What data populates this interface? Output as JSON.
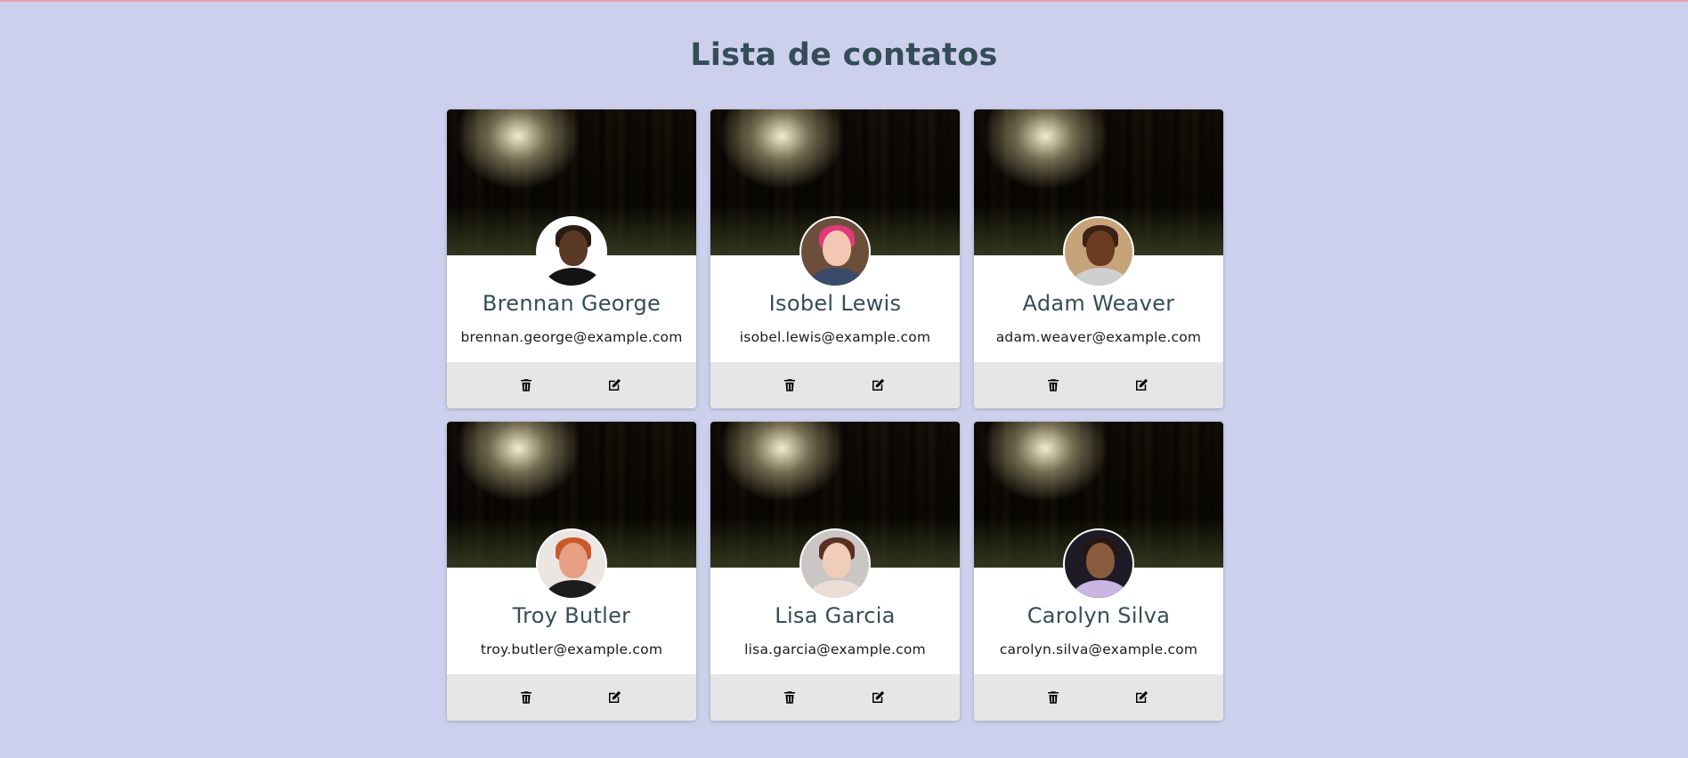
{
  "page": {
    "title": "Lista de contatos"
  },
  "colors": {
    "background": "#cdd0ec",
    "title": "#344d57",
    "card_footer": "#e6e6e6"
  },
  "icons": {
    "delete": "trash-icon",
    "edit": "edit-icon"
  },
  "contacts": [
    {
      "name": "Brennan George",
      "email": "brennan.george@example.com",
      "avatar": {
        "bg": "#ffffff",
        "skin": "#5a3a26",
        "hair": "#2a1c14",
        "shirt": "#141414"
      }
    },
    {
      "name": "Isobel Lewis",
      "email": "isobel.lewis@example.com",
      "avatar": {
        "bg": "#6b4f3b",
        "skin": "#f2c8b4",
        "hair": "#e23a78",
        "shirt": "#3a4b6a"
      }
    },
    {
      "name": "Adam Weaver",
      "email": "adam.weaver@example.com",
      "avatar": {
        "bg": "#c7a37a",
        "skin": "#6b3c22",
        "hair": "#3a2214",
        "shirt": "#cfcfcf"
      }
    },
    {
      "name": "Troy Butler",
      "email": "troy.butler@example.com",
      "avatar": {
        "bg": "#ece6e2",
        "skin": "#e7a083",
        "hair": "#c8592c",
        "shirt": "#1c1c1c"
      }
    },
    {
      "name": "Lisa Garcia",
      "email": "lisa.garcia@example.com",
      "avatar": {
        "bg": "#c9c6c4",
        "skin": "#f0cdb8",
        "hair": "#5a2e22",
        "shirt": "#e9ddd6"
      }
    },
    {
      "name": "Carolyn Silva",
      "email": "carolyn.silva@example.com",
      "avatar": {
        "bg": "#1e1b26",
        "skin": "#8a5a3e",
        "hair": "#231712",
        "shirt": "#c9b6e3"
      }
    }
  ]
}
